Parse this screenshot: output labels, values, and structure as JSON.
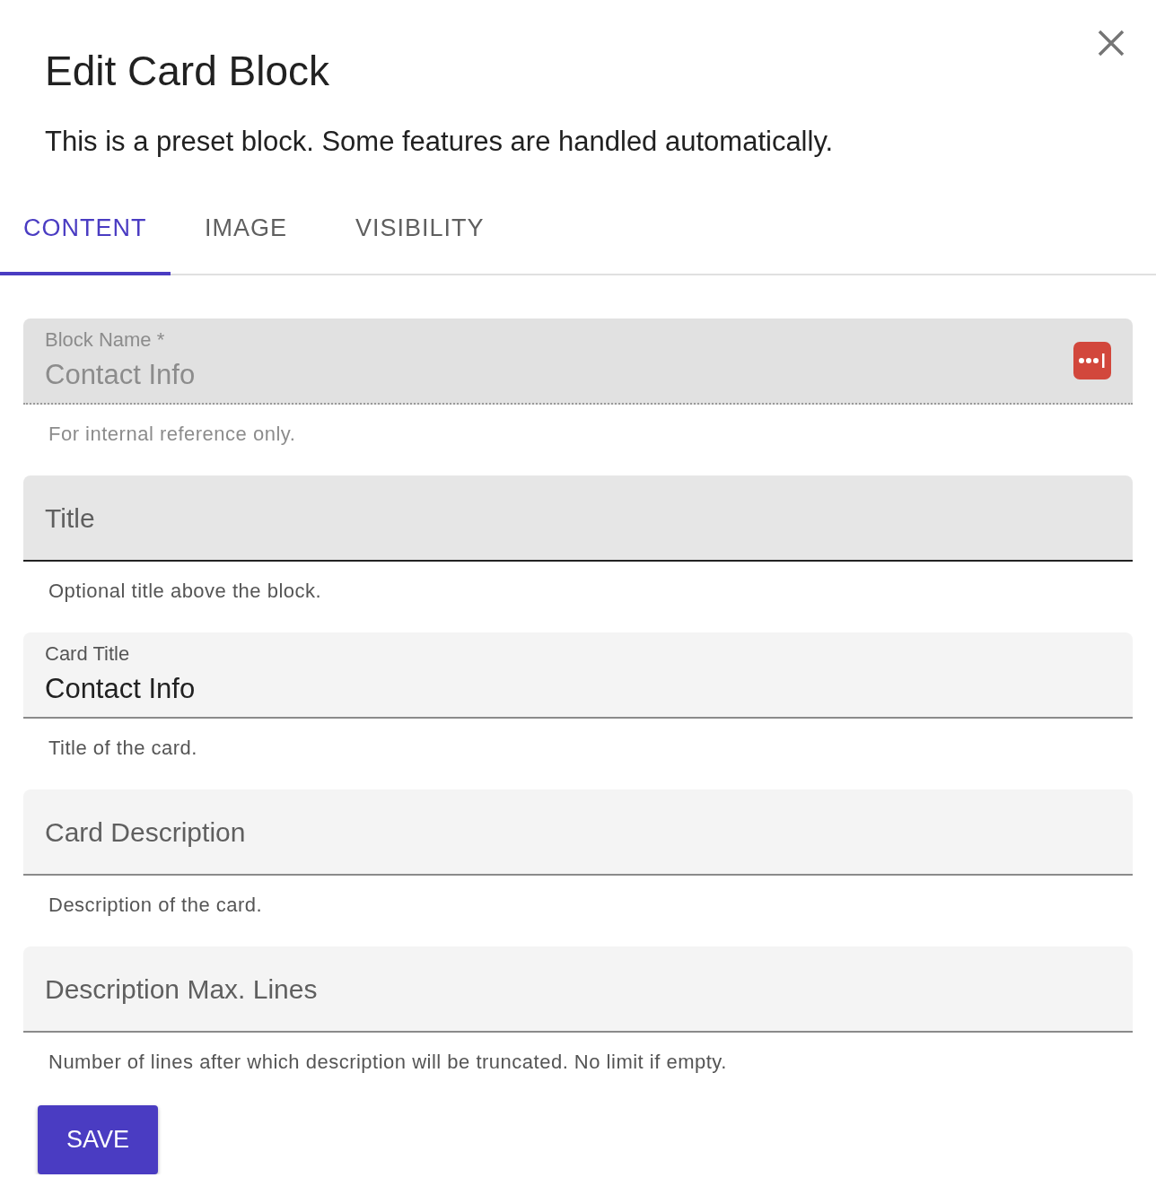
{
  "dialog": {
    "title": "Edit Card Block",
    "subtitle": "This is a preset block. Some features are handled automatically."
  },
  "tabs": [
    {
      "label": "CONTENT",
      "selected": true
    },
    {
      "label": "IMAGE",
      "selected": false
    },
    {
      "label": "VISIBILITY",
      "selected": false
    }
  ],
  "fields": [
    {
      "label": "Block Name *",
      "value": "Contact Info",
      "helper": "For internal reference only.",
      "disabled": true,
      "hovered": false,
      "action_icon": true
    },
    {
      "label": "Title",
      "helper": "Optional title above the block.",
      "disabled": false,
      "hovered": true,
      "action_icon": false
    },
    {
      "label": "Card Title",
      "value": "Contact Info",
      "helper": "Title of the card.",
      "disabled": false,
      "hovered": false,
      "action_icon": false
    },
    {
      "label": "Card Description",
      "helper": "Description of the card.",
      "disabled": false,
      "hovered": false,
      "action_icon": false
    },
    {
      "label": "Description Max. Lines",
      "helper": "Number of lines after which description will be truncated. No limit if empty.",
      "disabled": false,
      "hovered": false,
      "action_icon": false
    }
  ],
  "save_button": "SAVE"
}
